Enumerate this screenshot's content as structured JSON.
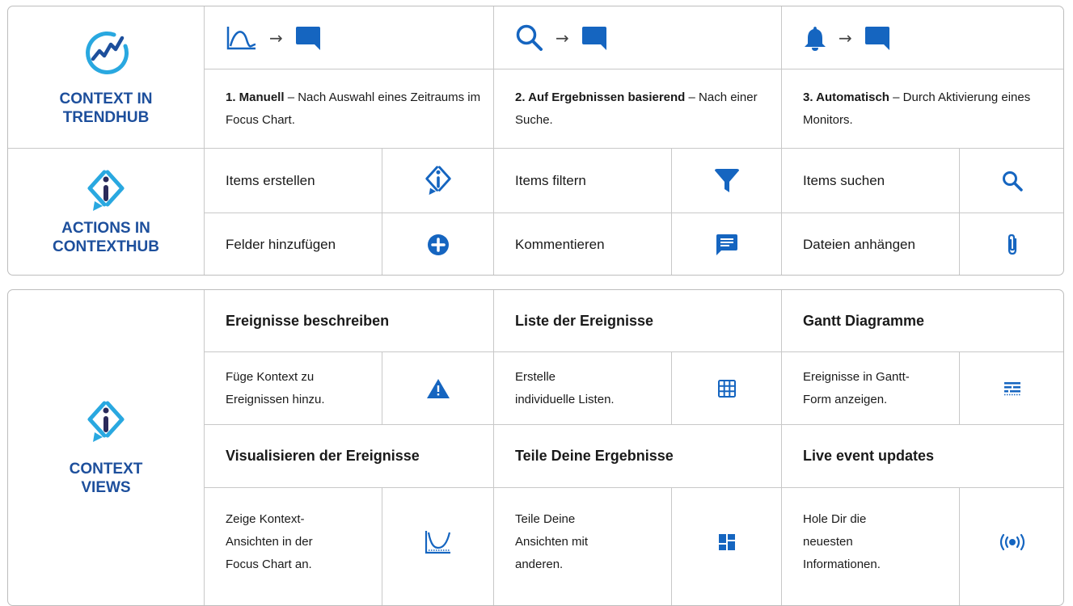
{
  "context_in_trendhub": {
    "title_line1": "CONTEXT IN",
    "title_line2": "TRENDHUB",
    "columns": [
      {
        "arrow": "→",
        "bold": "1. Manuell",
        "rest": " – Nach Auswahl eines Zeitraums im Focus Chart."
      },
      {
        "arrow": "→",
        "bold": "2. Auf Ergebnissen basierend",
        "rest": " – Nach einer Suche."
      },
      {
        "arrow": "→",
        "bold": "3. Automatisch",
        "rest": " – Durch Aktivierung eines Monitors."
      }
    ]
  },
  "actions_in_contexthub": {
    "title_line1": "ACTIONS IN",
    "title_line2": "CONTEXTHUB",
    "rows": [
      [
        "Items erstellen",
        "Items filtern",
        "Items suchen"
      ],
      [
        "Felder hinzufügen",
        "Kommentieren",
        "Dateien anhängen"
      ]
    ],
    "icons": [
      [
        "context-item-icon",
        "filter-icon",
        "search-icon"
      ],
      [
        "add-circle-icon",
        "comment-icon",
        "attachment-icon"
      ]
    ]
  },
  "context_views": {
    "title_line1": "CONTEXT",
    "title_line2": "VIEWS",
    "headers_row1": [
      "Ereignisse beschreiben",
      "Liste der Ereignisse",
      "Gantt Diagramme"
    ],
    "desc_row1": [
      [
        "Füge Kontext zu",
        "Ereignissen hinzu."
      ],
      [
        "Erstelle",
        "individuelle Listen."
      ],
      [
        "Ereignisse in Gantt-",
        "Form anzeigen."
      ]
    ],
    "headers_row2": [
      "Visualisieren der Ereignisse",
      "Teile Deine Ergebnisse",
      "Live event updates"
    ],
    "desc_row2": [
      [
        "Zeige Kontext-",
        "Ansichten in der",
        "Focus Chart an."
      ],
      [
        "Teile Deine",
        "Ansichten mit",
        "anderen."
      ],
      [
        "Hole Dir die",
        "neuesten",
        "Informationen."
      ]
    ]
  },
  "colors": {
    "brand_blue": "#1d4f9c",
    "icon_blue": "#1565c0",
    "accent_cyan": "#29a8e0"
  }
}
